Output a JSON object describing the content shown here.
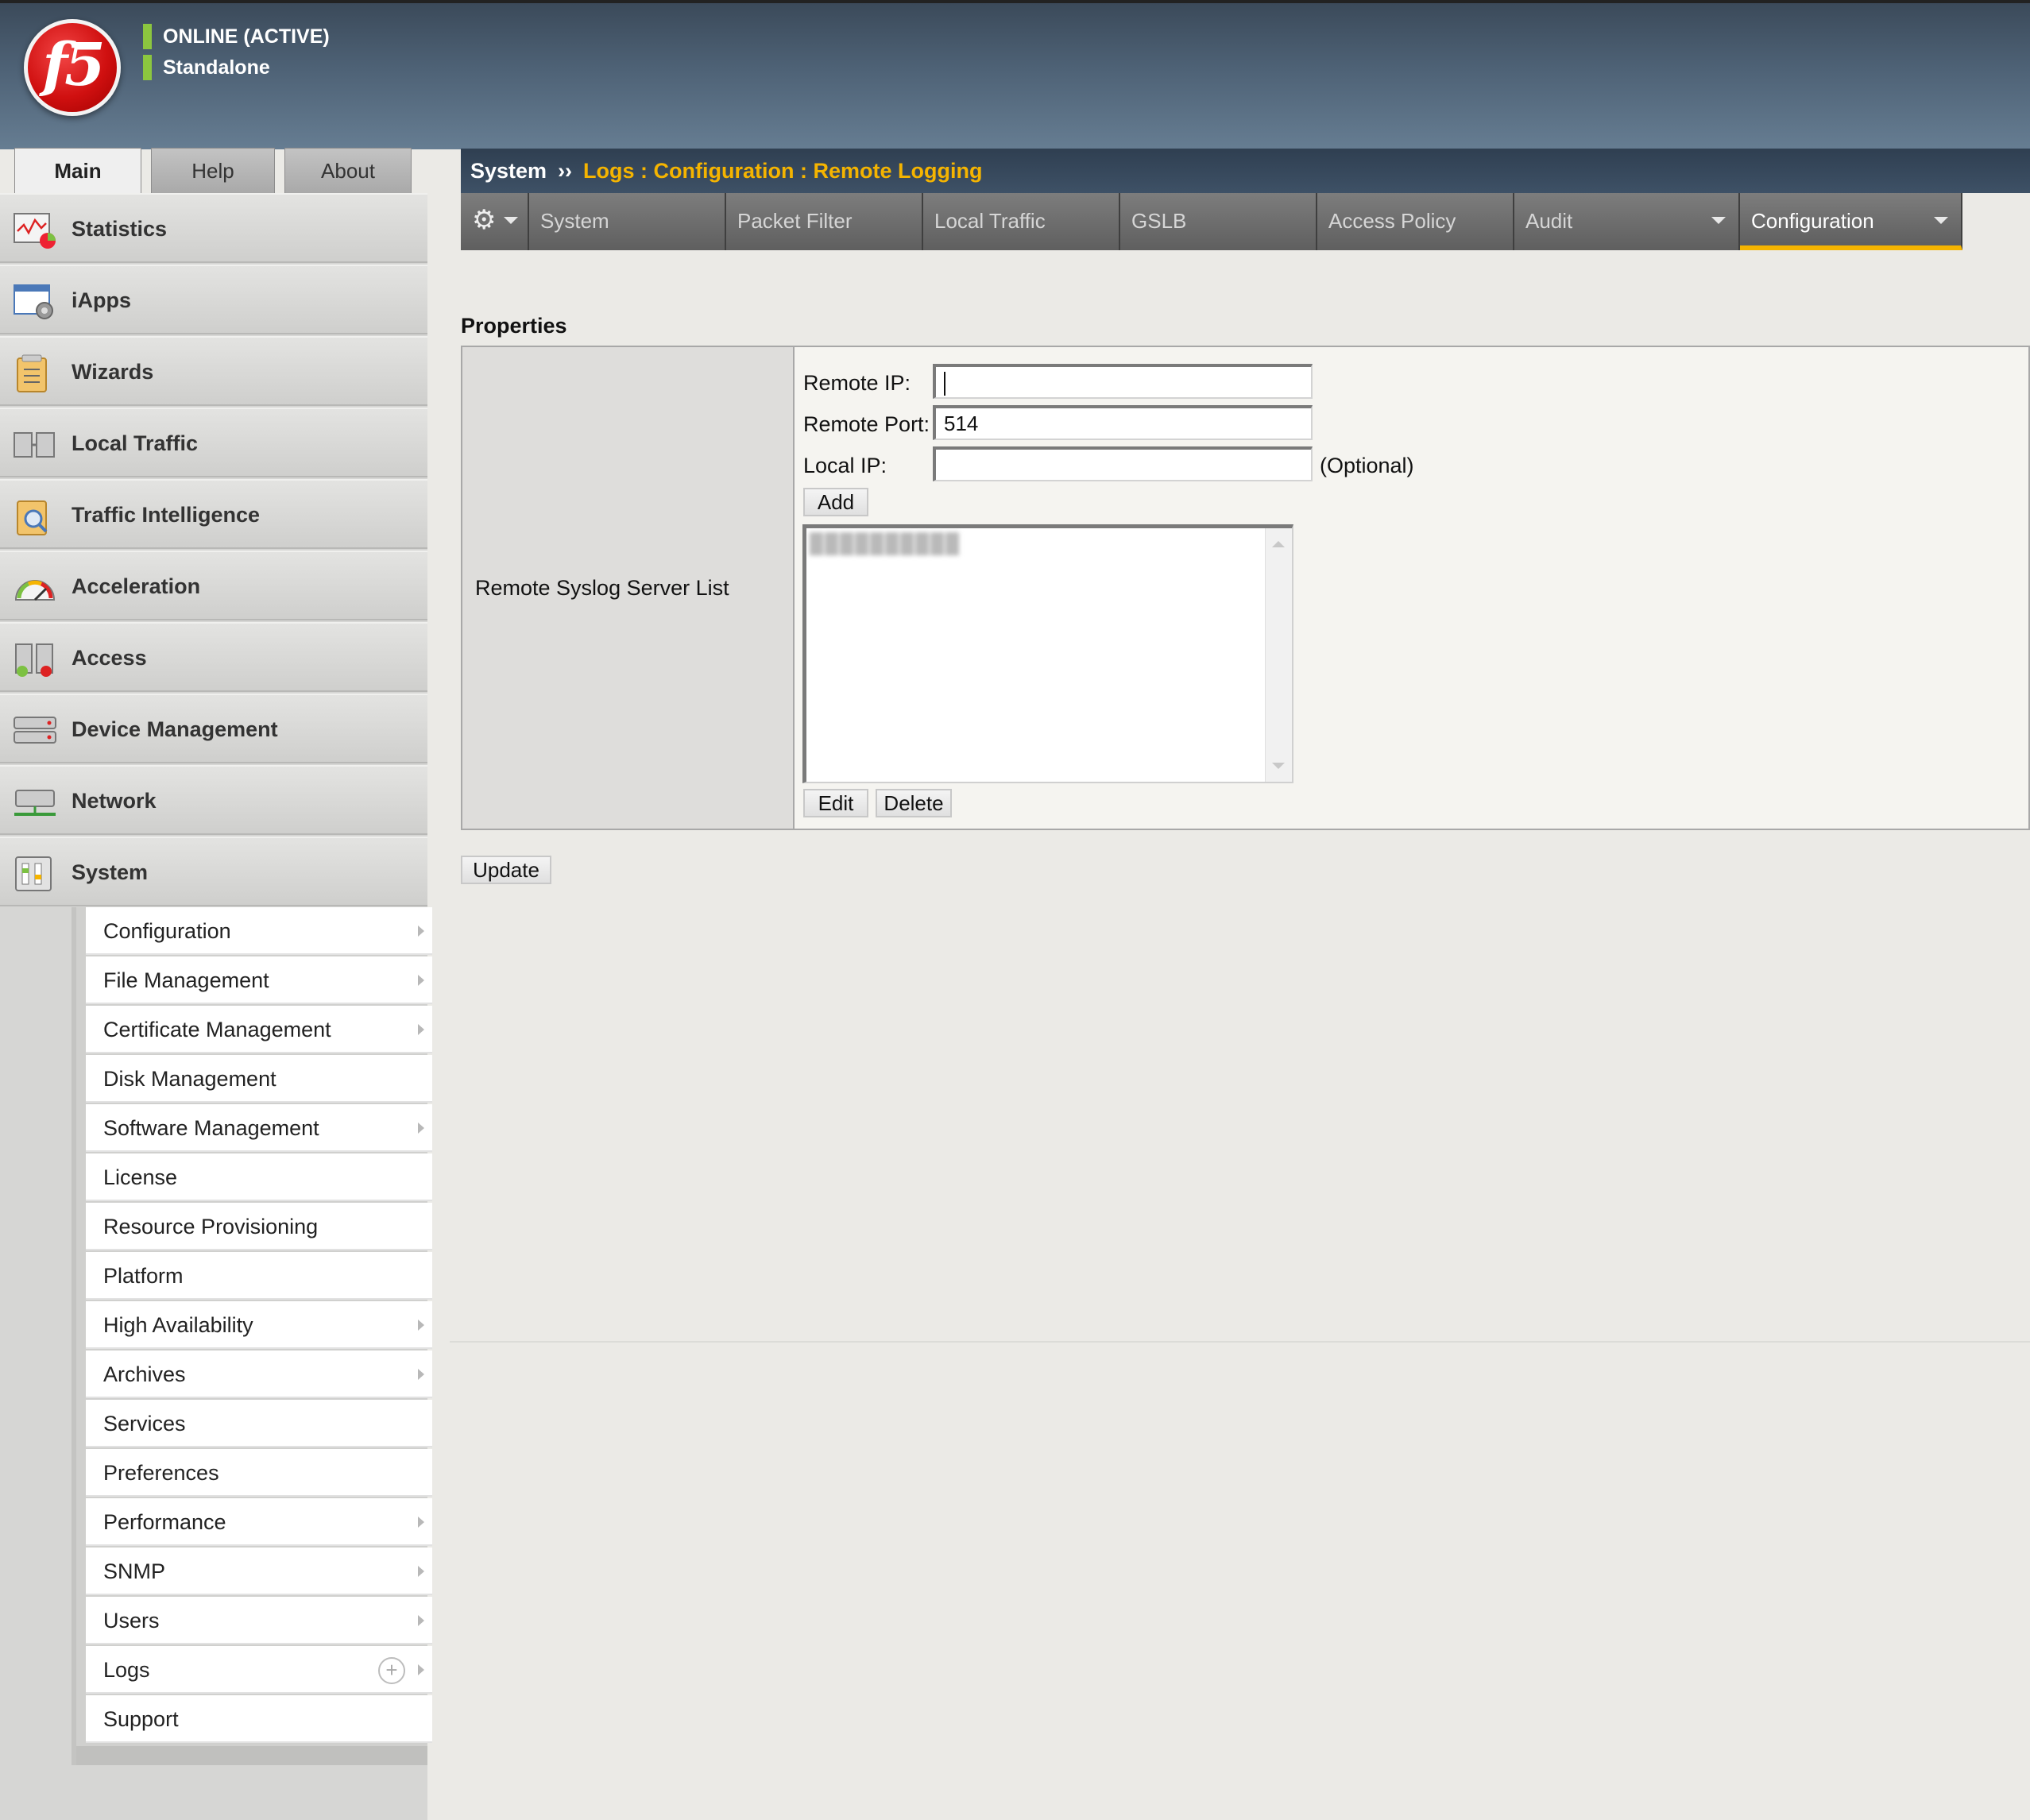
{
  "header": {
    "logo_text": "f5",
    "status_line1": "ONLINE (ACTIVE)",
    "status_line2": "Standalone"
  },
  "top_tabs": [
    {
      "label": "Main",
      "active": true
    },
    {
      "label": "Help",
      "active": false
    },
    {
      "label": "About",
      "active": false
    }
  ],
  "breadcrumb": {
    "root": "System",
    "separator": "››",
    "path": "Logs : Configuration : Remote Logging"
  },
  "subnav": {
    "gear_icon": "gear-icon",
    "items": [
      {
        "label": "System",
        "dropdown": false,
        "active": false
      },
      {
        "label": "Packet Filter",
        "dropdown": false,
        "active": false
      },
      {
        "label": "Local Traffic",
        "dropdown": false,
        "active": false
      },
      {
        "label": "GSLB",
        "dropdown": false,
        "active": false
      },
      {
        "label": "Access Policy",
        "dropdown": false,
        "active": false
      },
      {
        "label": "Audit",
        "dropdown": true,
        "active": false
      },
      {
        "label": "Configuration",
        "dropdown": true,
        "active": true
      }
    ],
    "accent_color": "#f5b400"
  },
  "sidebar": {
    "items": [
      {
        "label": "Statistics",
        "icon": "statistics-icon"
      },
      {
        "label": "iApps",
        "icon": "iapps-icon"
      },
      {
        "label": "Wizards",
        "icon": "wizards-icon"
      },
      {
        "label": "Local Traffic",
        "icon": "local-traffic-icon"
      },
      {
        "label": "Traffic Intelligence",
        "icon": "traffic-intelligence-icon"
      },
      {
        "label": "Acceleration",
        "icon": "acceleration-icon"
      },
      {
        "label": "Access",
        "icon": "access-icon"
      },
      {
        "label": "Device Management",
        "icon": "device-management-icon"
      },
      {
        "label": "Network",
        "icon": "network-icon"
      },
      {
        "label": "System",
        "icon": "system-icon"
      }
    ],
    "system_submenu": [
      {
        "label": "Configuration",
        "arrow": true
      },
      {
        "label": "File Management",
        "arrow": true
      },
      {
        "label": "Certificate Management",
        "arrow": true
      },
      {
        "label": "Disk Management",
        "arrow": false
      },
      {
        "label": "Software Management",
        "arrow": true
      },
      {
        "label": "License",
        "arrow": false
      },
      {
        "label": "Resource Provisioning",
        "arrow": false
      },
      {
        "label": "Platform",
        "arrow": false
      },
      {
        "label": "High Availability",
        "arrow": true
      },
      {
        "label": "Archives",
        "arrow": true
      },
      {
        "label": "Services",
        "arrow": false
      },
      {
        "label": "Preferences",
        "arrow": false
      },
      {
        "label": "Performance",
        "arrow": true
      },
      {
        "label": "SNMP",
        "arrow": true
      },
      {
        "label": "Users",
        "arrow": true
      },
      {
        "label": "Logs",
        "arrow": true,
        "plus": true
      },
      {
        "label": "Support",
        "arrow": false
      }
    ]
  },
  "properties": {
    "title": "Properties",
    "row_label": "Remote Syslog Server List",
    "remote_ip_label": "Remote IP:",
    "remote_ip_value": "",
    "remote_port_label": "Remote Port:",
    "remote_port_value": "514",
    "local_ip_label": "Local IP:",
    "local_ip_value": "",
    "local_ip_hint": "(Optional)",
    "add_button": "Add",
    "list_entries": [
      "██████████"
    ],
    "edit_button": "Edit",
    "delete_button": "Delete"
  },
  "update_button": "Update"
}
